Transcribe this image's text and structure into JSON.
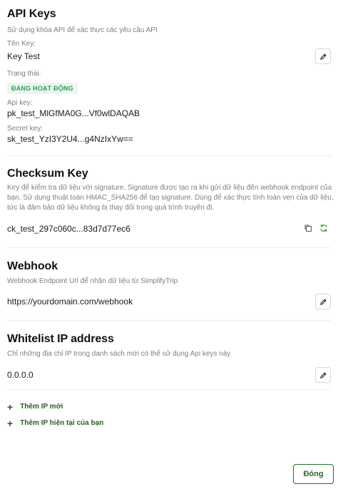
{
  "api_keys": {
    "title": "API Keys",
    "subtitle": "Sử dụng khóa API để xác thực các yêu cầu API",
    "key_name_label": "Tên Key:",
    "key_name_value": "Key Test",
    "status_label": "Trạng thái:",
    "status_value": "ĐANG HOẠT ĐỘNG",
    "api_key_label": "Api key:",
    "api_key_value": "pk_test_MlGfMA0G...Vf0wlDAQAB",
    "secret_key_label": "Secret key:",
    "secret_key_value": "sk_test_YzI3Y2U4...g4NzIxYw=="
  },
  "checksum": {
    "title": "Checksum Key",
    "description_line1": "Key để kiểm tra dữ liệu với signature. Signature được tạo ra khi gửi dữ liệu đến webhook endpoint của",
    "description_line2": "bạn. Sử dụng thuật toán HMAC_SHA256 để tạo signature. Dùng để xác thực tính toàn vẹn của dữ liệu,",
    "description_line3": "tức là đảm bảo dữ liệu không bị thay đổi trong quá trình truyền đi.",
    "value": "ck_test_297c060c...83d7d77ec6"
  },
  "webhook": {
    "title": "Webhook",
    "subtitle": "Webhook Endpoint Url để nhận dữ liệu từ SimplifyTrip",
    "value": "https://yourdomain.com/webhook"
  },
  "whitelist": {
    "title": "Whitelist IP address",
    "subtitle": "Chỉ những địa chỉ IP trong danh sách mới có thể sử dụng Api keys này",
    "ip_value": "0.0.0.0",
    "add_ip_label": "Thêm IP mới",
    "add_current_ip_label": "Thêm IP hiện tại của bạn"
  },
  "footer": {
    "close_label": "Đóng"
  },
  "colors": {
    "accent_green": "#2d6a2a",
    "badge_bg": "#e9f7ee",
    "badge_text": "#2f9a57"
  },
  "icons": {
    "edit": "pencil-icon",
    "copy": "copy-icon",
    "refresh": "refresh-icon",
    "plus": "plus-icon"
  }
}
